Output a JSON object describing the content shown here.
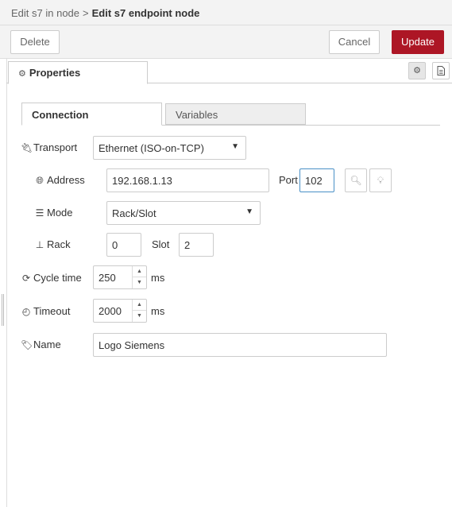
{
  "breadcrumb": {
    "parent": "Edit s7 in node",
    "separator": ">",
    "current": "Edit s7 endpoint node"
  },
  "toolbar": {
    "delete_label": "Delete",
    "cancel_label": "Cancel",
    "update_label": "Update",
    "update_color": "#ad1625"
  },
  "properties_tab": {
    "label": "Properties",
    "icon": "gear-icon"
  },
  "sub_tabs": [
    {
      "label": "Connection",
      "active": true
    },
    {
      "label": "Variables",
      "active": false
    }
  ],
  "form": {
    "transport": {
      "label": "Transport",
      "icon": "plug-icon",
      "value": "Ethernet (ISO-on-TCP)"
    },
    "address": {
      "label": "Address",
      "icon": "globe-icon",
      "value": "192.168.1.13"
    },
    "port": {
      "label": "Port",
      "value": "102"
    },
    "mode": {
      "label": "Mode",
      "icon": "sliders-icon",
      "value": "Rack/Slot"
    },
    "rack": {
      "label": "Rack",
      "icon": "sitemap-icon",
      "value": "0"
    },
    "slot": {
      "label": "Slot",
      "value": "2"
    },
    "cycle_time": {
      "label": "Cycle time",
      "icon": "refresh-icon",
      "value": "250",
      "unit": "ms"
    },
    "timeout": {
      "label": "Timeout",
      "icon": "clock-icon",
      "value": "2000",
      "unit": "ms"
    },
    "name": {
      "label": "Name",
      "icon": "tag-icon",
      "value": "Logo Siemens"
    }
  }
}
